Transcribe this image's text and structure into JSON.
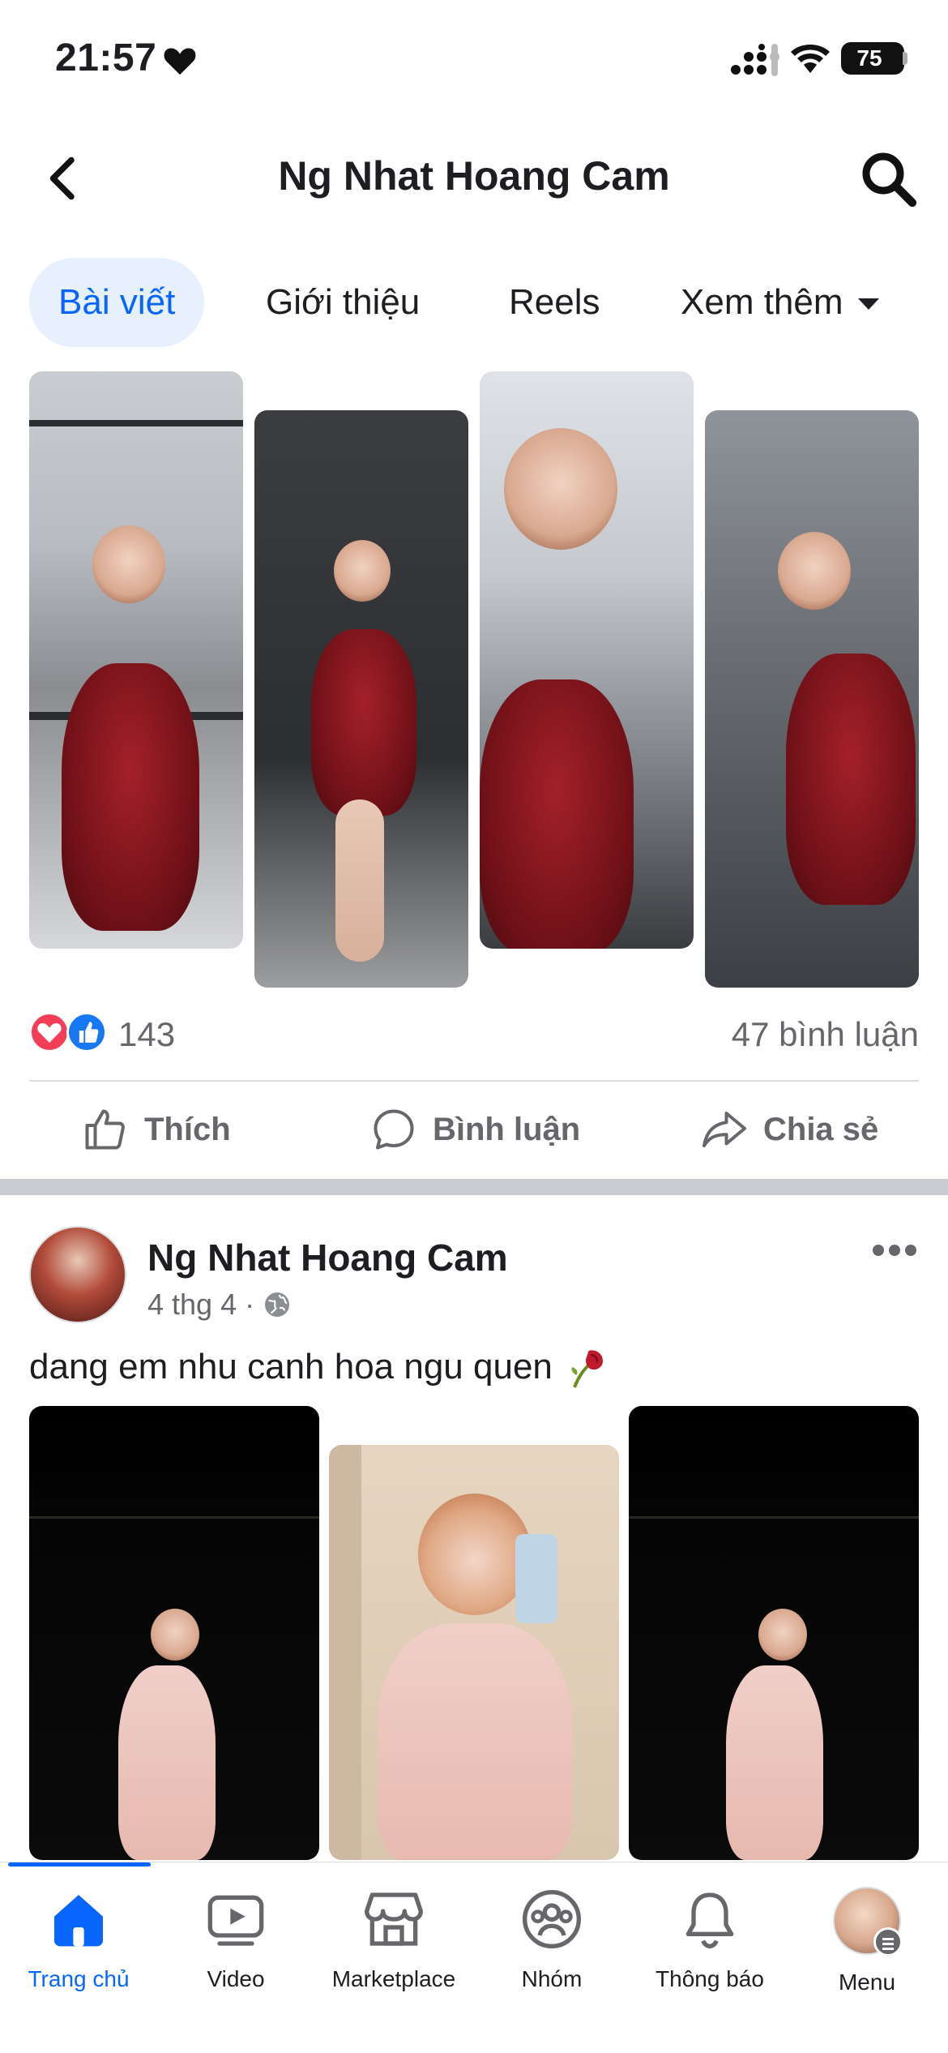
{
  "status_bar": {
    "time": "21:57",
    "battery": "75"
  },
  "header": {
    "title": "Ng Nhat Hoang Cam"
  },
  "tabs": [
    {
      "label": "Bài viết",
      "active": true
    },
    {
      "label": "Giới thiệu"
    },
    {
      "label": "Reels"
    },
    {
      "label": "Xem thêm"
    }
  ],
  "post1": {
    "reaction_count": "143",
    "comments": "47 bình luận",
    "actions": {
      "like": "Thích",
      "comment": "Bình luận",
      "share": "Chia sẻ"
    }
  },
  "post2": {
    "author": "Ng Nhat Hoang Cam",
    "date": "4 thg 4",
    "separator": "·",
    "caption": "dang em nhu canh hoa ngu quen"
  },
  "bottom_nav": [
    {
      "label": "Trang chủ",
      "icon": "home-icon",
      "active": true
    },
    {
      "label": "Video",
      "icon": "video-icon"
    },
    {
      "label": "Marketplace",
      "icon": "marketplace-icon"
    },
    {
      "label": "Nhóm",
      "icon": "groups-icon"
    },
    {
      "label": "Thông báo",
      "icon": "bell-icon"
    },
    {
      "label": "Menu",
      "icon": "profile-avatar"
    }
  ],
  "colors": {
    "accent": "#0866ff",
    "text": "#1c1e21",
    "muted": "#65676b",
    "love": "#f33e58",
    "like": "#1877f2"
  }
}
